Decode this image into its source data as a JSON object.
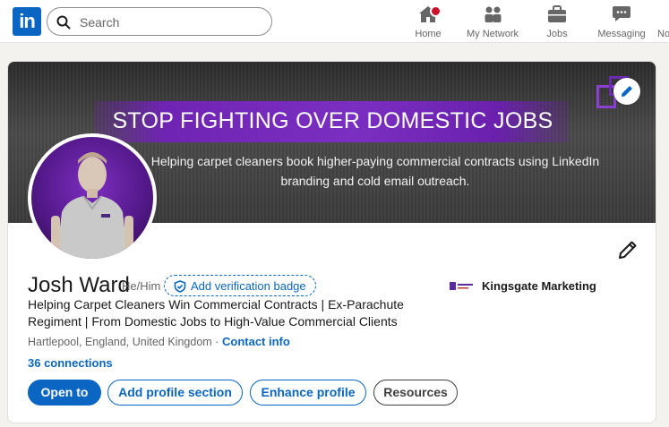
{
  "nav": {
    "logo_text": "in",
    "search_placeholder": "Search",
    "items": [
      {
        "label": "Home",
        "icon": "home-icon"
      },
      {
        "label": "My Network",
        "icon": "network-icon"
      },
      {
        "label": "Jobs",
        "icon": "briefcase-icon"
      },
      {
        "label": "Messaging",
        "icon": "messaging-icon"
      },
      {
        "label": "No",
        "icon": "bell-icon"
      }
    ]
  },
  "banner": {
    "headline": "STOP FIGHTING OVER DOMESTIC JOBS",
    "subtext": "Helping carpet cleaners book higher-paying commercial contracts using LinkedIn branding and cold email outreach.",
    "accent_color": "#7b2fc2"
  },
  "profile": {
    "name": "Josh Ward",
    "pronouns": "He/Him",
    "verification_label": "Add verification badge",
    "headline": "Helping Carpet Cleaners Win Commercial Contracts | Ex-Parachute Regiment | From Domestic Jobs to High-Value Commercial Clients",
    "location": "Hartlepool, England, United Kingdom ·",
    "contact_label": "Contact info",
    "connections": "36 connections",
    "company": "Kingsgate Marketing"
  },
  "actions": {
    "open_to": "Open to",
    "add_section": "Add profile section",
    "enhance": "Enhance profile",
    "resources": "Resources"
  },
  "colors": {
    "brand": "#0a66c2",
    "notification": "#cb112d"
  }
}
